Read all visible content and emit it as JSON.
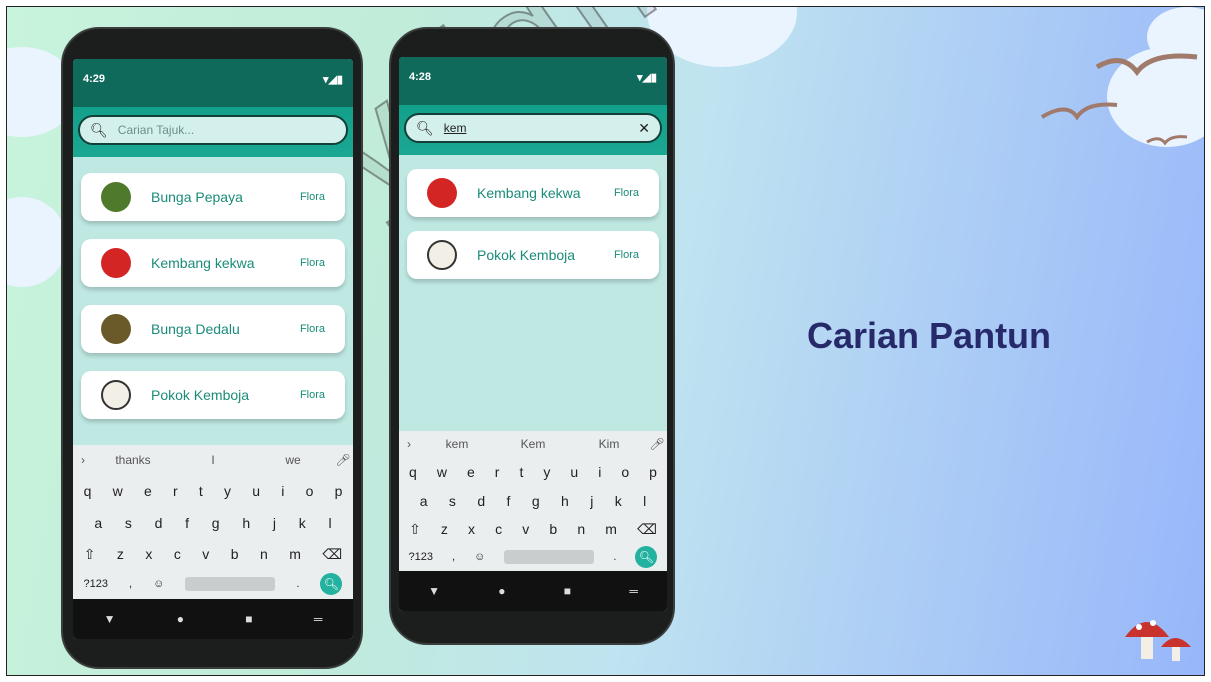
{
  "slide": {
    "title": "Carian Pantun",
    "watermark": "Copyright UK"
  },
  "phone_left": {
    "time": "4:29",
    "status_icons": "▾◢▮",
    "search_placeholder": "Carian Tajuk...",
    "results": [
      {
        "name": "Bunga Pepaya",
        "category": "Flora",
        "thumb_color": "#4f7a2c"
      },
      {
        "name": "Kembang kekwa",
        "category": "Flora",
        "thumb_color": "#d42525"
      },
      {
        "name": "Bunga Dedalu",
        "category": "Flora",
        "thumb_color": "#6a5a2a"
      },
      {
        "name": "Pokok Kemboja",
        "category": "Flora",
        "thumb_color": "#f2efe6"
      }
    ],
    "suggestions": [
      "thanks",
      "I",
      "we"
    ],
    "keys_row1": [
      "q",
      "w",
      "e",
      "r",
      "t",
      "y",
      "u",
      "i",
      "o",
      "p"
    ],
    "keys_row2": [
      "a",
      "s",
      "d",
      "f",
      "g",
      "h",
      "j",
      "k",
      "l"
    ],
    "keys_row3": [
      "z",
      "x",
      "c",
      "v",
      "b",
      "n",
      "m"
    ],
    "key_symbols": "?123",
    "key_comma": ",",
    "key_period": "."
  },
  "phone_right": {
    "time": "4:28",
    "status_icons": "▾◢▮",
    "search_value": "kem",
    "results": [
      {
        "name": "Kembang kekwa",
        "category": "Flora",
        "thumb_color": "#d42525"
      },
      {
        "name": "Pokok Kemboja",
        "category": "Flora",
        "thumb_color": "#f2efe6"
      }
    ],
    "suggestions": [
      "kem",
      "Kem",
      "Kim"
    ],
    "keys_row1": [
      "q",
      "w",
      "e",
      "r",
      "t",
      "y",
      "u",
      "i",
      "o",
      "p"
    ],
    "keys_row2": [
      "a",
      "s",
      "d",
      "f",
      "g",
      "h",
      "j",
      "k",
      "l"
    ],
    "keys_row3": [
      "z",
      "x",
      "c",
      "v",
      "b",
      "n",
      "m"
    ],
    "key_symbols": "?123",
    "key_comma": ",",
    "key_period": "."
  },
  "colors": {
    "status_bar": "#0f6a5b",
    "app_bar": "#12a08a",
    "accent_text": "#1a8c79",
    "title": "#262a6b"
  }
}
